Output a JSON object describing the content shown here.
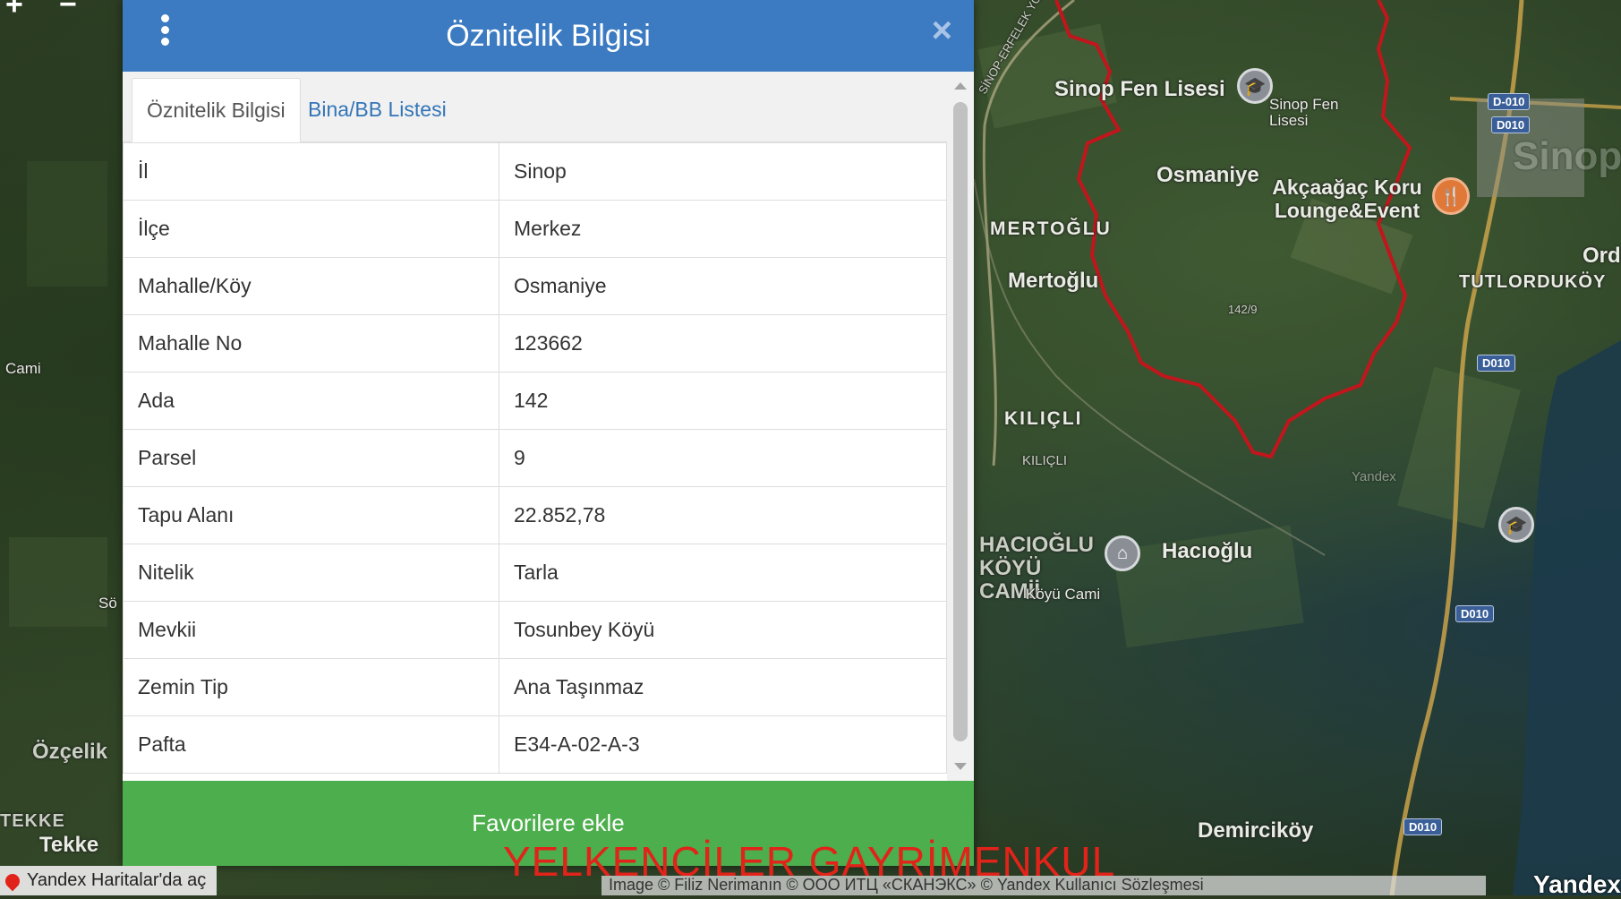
{
  "dialog": {
    "title": "Öznitelik Bilgisi",
    "close_glyph": "×",
    "menu_icon": "kebab-menu-icon",
    "tabs": [
      {
        "label": "Öznitelik Bilgisi",
        "active": true
      },
      {
        "label": "Bina/BB Listesi",
        "active": false
      }
    ],
    "rows": [
      {
        "key": "İl",
        "value": "Sinop"
      },
      {
        "key": "İlçe",
        "value": "Merkez"
      },
      {
        "key": "Mahalle/Köy",
        "value": "Osmaniye"
      },
      {
        "key": "Mahalle No",
        "value": "123662"
      },
      {
        "key": "Ada",
        "value": "142"
      },
      {
        "key": "Parsel",
        "value": "9"
      },
      {
        "key": "Tapu Alanı",
        "value": "22.852,78"
      },
      {
        "key": "Nitelik",
        "value": "Tarla"
      },
      {
        "key": "Mevkii",
        "value": "Tosunbey Köyü"
      },
      {
        "key": "Zemin Tip",
        "value": "Ana Taşınmaz"
      },
      {
        "key": "Pafta",
        "value": "E34-A-02-A-3"
      }
    ],
    "favorite_button": "Favorilere ekle"
  },
  "map": {
    "labels": {
      "sinop_fen_lisesi": "Sinop Fen Lisesi",
      "sinop_fen_lisesi_poi": "Sinop Fen Lisesi",
      "osmaniye": "Osmaniye",
      "akcaagac": "Akçaağaç Koru Lounge&Event",
      "mertoglu_caps": "MERTOĞLU",
      "mertoglu": "Mertoğlu",
      "kilicli": "KILIÇLI",
      "kilicli_small": "KILIÇLI",
      "hacioglu_koyu_cami": "HACIOĞLU KÖYÜ CAMİİ",
      "hacioglu": "Hacıoğlu",
      "hacioglu_koyu_cami_small": "Köyü Cami",
      "demirci_koy": "Demirciköy",
      "tutlorduköy": "TUTLORDUKÖY",
      "ord": "Ord",
      "sinop_big": "Sinop",
      "cami": "Cami",
      "ozcelik": "Özçelik",
      "tekke_caps": "TEKKE",
      "tekke": "Tekke",
      "parcel_tag": "142/9",
      "yandex_faint": "Yandex",
      "road_name": "SİNOP-ERFELEK YOLU",
      "so": "Sö"
    },
    "road_badges": {
      "d010_top": "D-010",
      "d010_a": "D010",
      "d010_b": "D010",
      "d010_c": "D010",
      "d010_d": "D010"
    },
    "watermark": "YELKENCİLER GAYRİMENKUL",
    "open_in_yandex": "Yandex Haritalar'da aç",
    "copyright": "Image ©      Filiz Nerimanın  © ООО ИТЦ «СКАНЭКС»  © Yandex Kullanıcı Sözleşmesi",
    "logo": "Yandex",
    "zoom_in": "+",
    "zoom_out": "−"
  },
  "colors": {
    "header": "#3c7bc2",
    "favorite": "#4cae4c",
    "parcel_outline": "#c0161c",
    "watermark": "#e2231a"
  }
}
